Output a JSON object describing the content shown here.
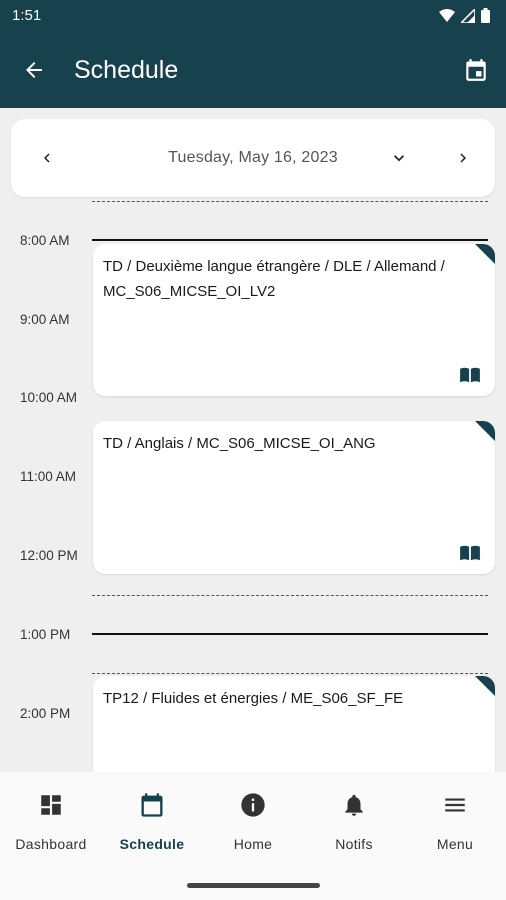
{
  "status_bar": {
    "time": "1:51"
  },
  "app_bar": {
    "title": "Schedule"
  },
  "date_picker": {
    "date": "Tuesday, May 16, 2023"
  },
  "timeline": {
    "hours": [
      "8:00 AM",
      "9:00 AM",
      "10:00 AM",
      "11:00 AM",
      "12:00 PM",
      "1:00 PM",
      "2:00 PM"
    ],
    "events": [
      {
        "title": "TD / Deuxième langue étrangère / DLE / Allemand / MC_S06_MICSE_OI_LV2",
        "icon": "book-open-icon"
      },
      {
        "title": "TD / Anglais / MC_S06_MICSE_OI_ANG",
        "icon": "book-open-icon"
      },
      {
        "title": "TP12 / Fluides et énergies / ME_S06_SF_FE",
        "icon": "book-open-icon"
      }
    ]
  },
  "bottom_nav": {
    "items": [
      {
        "label": "Dashboard",
        "icon": "dashboard-icon"
      },
      {
        "label": "Schedule",
        "icon": "calendar-icon"
      },
      {
        "label": "Home",
        "icon": "info-icon"
      },
      {
        "label": "Notifs",
        "icon": "bell-icon"
      },
      {
        "label": "Menu",
        "icon": "menu-icon"
      }
    ]
  },
  "colors": {
    "primary": "#17414c",
    "background": "#efefef",
    "card": "#ffffff"
  }
}
